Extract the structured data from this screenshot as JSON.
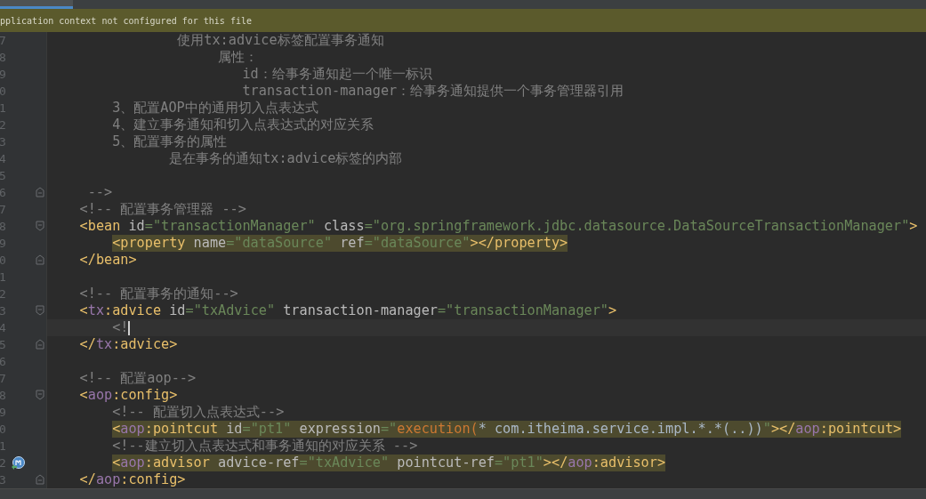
{
  "banner": {
    "text": "pplication context not configured for this file"
  },
  "lines": [
    {
      "number": "7",
      "kind": "text",
      "highlighted": false,
      "caret": false,
      "tokens": [
        {
          "kind": "comment",
          "text": "                使用tx:advice标签配置事务通知"
        }
      ]
    },
    {
      "number": "8",
      "kind": "text",
      "highlighted": false,
      "caret": false,
      "tokens": [
        {
          "kind": "comment",
          "text": "                     属性："
        }
      ]
    },
    {
      "number": "9",
      "kind": "text",
      "highlighted": false,
      "caret": false,
      "tokens": [
        {
          "kind": "comment",
          "text": "                        id：给事务通知起一个唯一标识"
        }
      ]
    },
    {
      "number": "0",
      "kind": "text",
      "highlighted": false,
      "caret": false,
      "tokens": [
        {
          "kind": "comment",
          "text": "                        transaction-manager：给事务通知提供一个事务管理器引用"
        }
      ]
    },
    {
      "number": "1",
      "kind": "text",
      "highlighted": false,
      "caret": false,
      "tokens": [
        {
          "kind": "comment",
          "text": "        3、配置AOP中的通用切入点表达式"
        }
      ]
    },
    {
      "number": "2",
      "kind": "text",
      "highlighted": false,
      "caret": false,
      "tokens": [
        {
          "kind": "comment",
          "text": "        4、建立事务通知和切入点表达式的对应关系"
        }
      ]
    },
    {
      "number": "3",
      "kind": "text",
      "highlighted": false,
      "caret": false,
      "tokens": [
        {
          "kind": "comment",
          "text": "        5、配置事务的属性"
        }
      ]
    },
    {
      "number": "4",
      "kind": "text",
      "highlighted": false,
      "caret": false,
      "tokens": [
        {
          "kind": "comment",
          "text": "               是在事务的通知tx:advice标签的内部"
        }
      ]
    },
    {
      "number": "5",
      "kind": "text"
    },
    {
      "number": "6",
      "kind": "close",
      "highlighted": false,
      "caret": false,
      "tokens": [
        {
          "kind": "comment",
          "text": "     -->"
        }
      ]
    },
    {
      "number": "7",
      "kind": "text",
      "highlighted": false,
      "caret": false,
      "tokens": [
        {
          "kind": "comment",
          "text": "    <!-- 配置事务管理器 -->"
        }
      ]
    },
    {
      "number": "8",
      "kind": "open",
      "highlighted": false,
      "caret": false,
      "tokens": [
        {
          "kind": "punct",
          "text": "    <"
        },
        {
          "kind": "tag",
          "text": "bean"
        },
        {
          "kind": "attr",
          "text": " id"
        },
        {
          "kind": "value",
          "text": "=\"transactionManager\""
        },
        {
          "kind": "attr",
          "text": " class"
        },
        {
          "kind": "value",
          "text": "=\"org.springframework.jdbc.datasource.DataSourceTransactionManager\""
        },
        {
          "kind": "punct",
          "text": ">"
        }
      ]
    },
    {
      "number": "9",
      "kind": "text",
      "highlighted": true,
      "caret": false,
      "tokens": [
        {
          "kind": "punct",
          "text": "        <"
        },
        {
          "kind": "tag",
          "text": "property"
        },
        {
          "kind": "attr",
          "text": " name"
        },
        {
          "kind": "value",
          "text": "=\"dataSource\""
        },
        {
          "kind": "attr",
          "text": " ref"
        },
        {
          "kind": "value",
          "text": "=\"dataSource\""
        },
        {
          "kind": "punct",
          "text": "></"
        },
        {
          "kind": "tag",
          "text": "property"
        },
        {
          "kind": "punct",
          "text": ">"
        }
      ]
    },
    {
      "number": "0",
      "kind": "close",
      "highlighted": false,
      "caret": false,
      "tokens": [
        {
          "kind": "punct",
          "text": "    </"
        },
        {
          "kind": "tag",
          "text": "bean"
        },
        {
          "kind": "punct",
          "text": ">"
        }
      ]
    },
    {
      "number": "1",
      "kind": "text"
    },
    {
      "number": "2",
      "kind": "text",
      "highlighted": false,
      "caret": false,
      "tokens": [
        {
          "kind": "comment",
          "text": "    <!-- 配置事务的通知-->"
        }
      ]
    },
    {
      "number": "3",
      "kind": "open",
      "highlighted": false,
      "caret": false,
      "tokens": [
        {
          "kind": "punct",
          "text": "    <"
        },
        {
          "kind": "ns",
          "text": "tx"
        },
        {
          "kind": "tag",
          "text": ":advice"
        },
        {
          "kind": "attr",
          "text": " id"
        },
        {
          "kind": "value",
          "text": "=\"txAdvice\""
        },
        {
          "kind": "attr",
          "text": " transaction-manager"
        },
        {
          "kind": "value",
          "text": "=\"transactionManager\""
        },
        {
          "kind": "punct",
          "text": ">"
        }
      ]
    },
    {
      "number": "4",
      "kind": "text",
      "highlighted": false,
      "caret": true,
      "tokens": [
        {
          "kind": "comment",
          "text": "        <!"
        }
      ]
    },
    {
      "number": "5",
      "kind": "close",
      "highlighted": false,
      "caret": false,
      "tokens": [
        {
          "kind": "punct",
          "text": "    </"
        },
        {
          "kind": "ns",
          "text": "tx"
        },
        {
          "kind": "tag",
          "text": ":advice"
        },
        {
          "kind": "punct",
          "text": ">"
        }
      ]
    },
    {
      "number": "6",
      "kind": "text"
    },
    {
      "number": "7",
      "kind": "text",
      "highlighted": false,
      "caret": false,
      "tokens": [
        {
          "kind": "comment",
          "text": "    <!-- 配置aop-->"
        }
      ]
    },
    {
      "number": "8",
      "kind": "open",
      "highlighted": false,
      "caret": false,
      "tokens": [
        {
          "kind": "punct",
          "text": "    <"
        },
        {
          "kind": "ns",
          "text": "aop"
        },
        {
          "kind": "tag",
          "text": ":config"
        },
        {
          "kind": "punct",
          "text": ">"
        }
      ]
    },
    {
      "number": "9",
      "kind": "text",
      "highlighted": false,
      "caret": false,
      "tokens": [
        {
          "kind": "comment",
          "text": "        <!-- 配置切入点表达式-->"
        }
      ]
    },
    {
      "number": "0",
      "kind": "text",
      "highlighted": true,
      "caret": false,
      "tokens": [
        {
          "kind": "punct",
          "text": "        <"
        },
        {
          "kind": "ns",
          "text": "aop"
        },
        {
          "kind": "tag",
          "text": ":pointcut"
        },
        {
          "kind": "attr",
          "text": " id"
        },
        {
          "kind": "value",
          "text": "=\"pt1\""
        },
        {
          "kind": "attr",
          "text": " expression"
        },
        {
          "kind": "value",
          "text": "=\""
        },
        {
          "kind": "keyword",
          "text": "execution("
        },
        {
          "kind": "plain",
          "text": "* com.itheima.service.impl.*.*(..))"
        },
        {
          "kind": "value",
          "text": "\""
        },
        {
          "kind": "punct",
          "text": "></"
        },
        {
          "kind": "ns",
          "text": "aop"
        },
        {
          "kind": "tag",
          "text": ":pointcut"
        },
        {
          "kind": "punct",
          "text": ">"
        }
      ]
    },
    {
      "number": "1",
      "kind": "text",
      "highlighted": false,
      "caret": false,
      "tokens": [
        {
          "kind": "comment",
          "text": "        <!--建立切入点表达式和事务通知的对应关系 -->"
        }
      ]
    },
    {
      "number": "2",
      "kind": "marked",
      "highlighted": true,
      "caret": false,
      "tokens": [
        {
          "kind": "punct",
          "text": "        <"
        },
        {
          "kind": "ns",
          "text": "aop"
        },
        {
          "kind": "tag",
          "text": ":advisor"
        },
        {
          "kind": "attr",
          "text": " advice-ref"
        },
        {
          "kind": "value",
          "text": "=\"txAdvice\""
        },
        {
          "kind": "attr",
          "text": " pointcut-ref"
        },
        {
          "kind": "value",
          "text": "=\"pt1\""
        },
        {
          "kind": "punct",
          "text": "></"
        },
        {
          "kind": "ns",
          "text": "aop"
        },
        {
          "kind": "tag",
          "text": ":advisor"
        },
        {
          "kind": "punct",
          "text": ">"
        }
      ]
    },
    {
      "number": "3",
      "kind": "close",
      "highlighted": false,
      "caret": false,
      "tokens": [
        {
          "kind": "punct",
          "text": "    </"
        },
        {
          "kind": "ns",
          "text": "aop"
        },
        {
          "kind": "tag",
          "text": ":config"
        },
        {
          "kind": "punct",
          "text": ">"
        }
      ]
    }
  ]
}
